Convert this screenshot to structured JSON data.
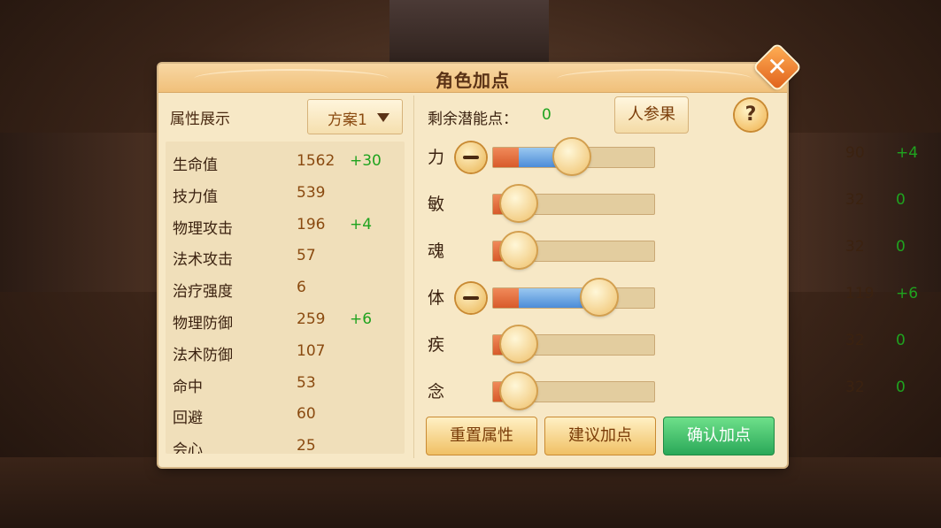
{
  "dialog": {
    "title": "角色加点"
  },
  "left": {
    "header": "属性展示",
    "scheme": "方案1",
    "attributes": [
      {
        "name": "生命值",
        "value": "1562",
        "bonus": "+30"
      },
      {
        "name": "技力值",
        "value": "539",
        "bonus": ""
      },
      {
        "name": "物理攻击",
        "value": "196",
        "bonus": "+4"
      },
      {
        "name": "法术攻击",
        "value": "57",
        "bonus": ""
      },
      {
        "name": "治疗强度",
        "value": "6",
        "bonus": ""
      },
      {
        "name": "物理防御",
        "value": "259",
        "bonus": "+6"
      },
      {
        "name": "法术防御",
        "value": "107",
        "bonus": ""
      },
      {
        "name": "命中",
        "value": "53",
        "bonus": ""
      },
      {
        "name": "回避",
        "value": "60",
        "bonus": ""
      },
      {
        "name": "会心",
        "value": "25",
        "bonus": ""
      }
    ]
  },
  "right": {
    "remaining_label": "剩余潜能点：",
    "remaining_value": "0",
    "reference_button": "人参果",
    "help_icon": "?",
    "stats": [
      {
        "label": "力",
        "value": "90",
        "bonus": "+4",
        "has_minus": true,
        "base_fraction": 0.16,
        "total_fraction": 0.49
      },
      {
        "label": "敏",
        "value": "32",
        "bonus": "0",
        "has_minus": false,
        "base_fraction": 0.16,
        "total_fraction": 0.16
      },
      {
        "label": "魂",
        "value": "32",
        "bonus": "0",
        "has_minus": false,
        "base_fraction": 0.16,
        "total_fraction": 0.16
      },
      {
        "label": "体",
        "value": "119",
        "bonus": "+6",
        "has_minus": true,
        "base_fraction": 0.16,
        "total_fraction": 0.66
      },
      {
        "label": "疾",
        "value": "32",
        "bonus": "0",
        "has_minus": false,
        "base_fraction": 0.16,
        "total_fraction": 0.16
      },
      {
        "label": "念",
        "value": "32",
        "bonus": "0",
        "has_minus": false,
        "base_fraction": 0.16,
        "total_fraction": 0.16
      }
    ]
  },
  "buttons": {
    "reset": "重置属性",
    "suggest": "建议加点",
    "confirm": "确认加点"
  },
  "icons": {
    "close": "close-icon",
    "help": "help-icon",
    "dropdown": "chevron-down-icon",
    "minus": "minus-icon"
  },
  "colors": {
    "bonus_green": "#1fa31f",
    "confirm_green": "#2aa858",
    "accent_orange": "#e0601a"
  }
}
